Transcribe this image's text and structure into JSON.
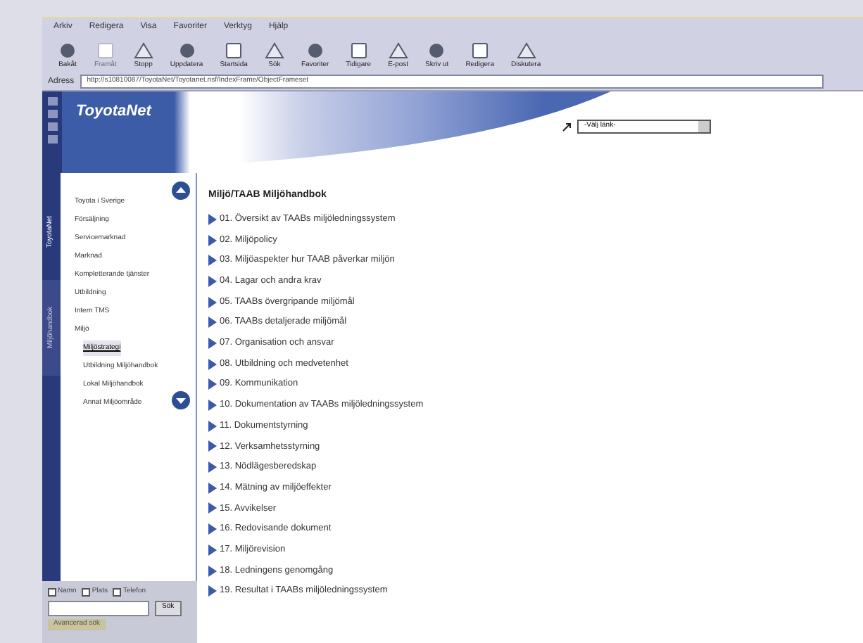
{
  "menu": [
    "Arkiv",
    "Redigera",
    "Visa",
    "Favoriter",
    "Verktyg",
    "Hjälp"
  ],
  "toolbar": [
    {
      "label": "Bakåt",
      "disabled": false
    },
    {
      "label": "Framåt",
      "disabled": true
    },
    {
      "label": "Stopp",
      "disabled": false
    },
    {
      "label": "Uppdatera",
      "disabled": false
    },
    {
      "label": "Startsida",
      "disabled": false
    },
    {
      "label": "Sök",
      "disabled": false
    },
    {
      "label": "Favoriter",
      "disabled": false
    },
    {
      "label": "Tidigare",
      "disabled": false
    },
    {
      "label": "E-post",
      "disabled": false
    },
    {
      "label": "Skriv ut",
      "disabled": false
    },
    {
      "label": "Redigera",
      "disabled": false
    },
    {
      "label": "Diskutera",
      "disabled": false
    }
  ],
  "address": {
    "label": "Adress",
    "value": "http://s10810087/ToyotaNet/Toyotanet.nsf/IndexFrame/ObjectFrameset"
  },
  "header": {
    "logo": "ToyotaNet",
    "link_select": "-Välj länk-"
  },
  "side_tabs": [
    {
      "label": "ToyotaNet",
      "selected": true
    },
    {
      "label": "Miljöhandbok",
      "selected": false
    }
  ],
  "nav": [
    {
      "label": "Toyota i Sverige",
      "selected": false
    },
    {
      "label": "Försäljning",
      "selected": false
    },
    {
      "label": "Servicemarknad",
      "selected": false
    },
    {
      "label": "Marknad",
      "selected": false
    },
    {
      "label": "Kompletterande tjänster",
      "selected": false
    },
    {
      "label": "Utbildning",
      "selected": false
    },
    {
      "label": "Intern TMS",
      "selected": false
    },
    {
      "label": "Miljö",
      "selected": false,
      "children": [
        {
          "label": "Miljöstrategi",
          "selected": true
        },
        {
          "label": "Utbildning Miljöhandbok",
          "selected": false
        },
        {
          "label": "Lokal Miljöhandbok",
          "selected": false
        },
        {
          "label": "Annat Miljöområde",
          "selected": false
        }
      ]
    }
  ],
  "search": {
    "options": [
      {
        "label": "Namn",
        "checked": false
      },
      {
        "label": "Plats",
        "checked": false
      },
      {
        "label": "Telefon",
        "checked": false
      }
    ],
    "button": "Sök",
    "advanced": "Avancerad sök"
  },
  "content": {
    "title": "Miljö/TAAB Miljöhandbok",
    "items": [
      "01. Översikt av TAABs miljöledningssystem",
      "02. Miljöpolicy",
      "03. Miljöaspekter hur TAAB påverkar miljön",
      "04. Lagar och andra krav",
      "05. TAABs övergripande miljömål",
      "06. TAABs detaljerade miljömål",
      "07. Organisation och ansvar",
      "08. Utbildning och medvetenhet",
      "09. Kommunikation",
      "10. Dokumentation av TAABs miljöledningssystem",
      "11. Dokumentstyrning",
      "12. Verksamhetsstyrning",
      "13. Nödlägesberedskap",
      "14. Mätning av miljöeffekter",
      "15. Avvikelser",
      "16. Redovisande dokument",
      "17. Miljörevision",
      "18. Ledningens genomgång",
      "19. Resultat i TAABs miljöledningssystem"
    ]
  }
}
